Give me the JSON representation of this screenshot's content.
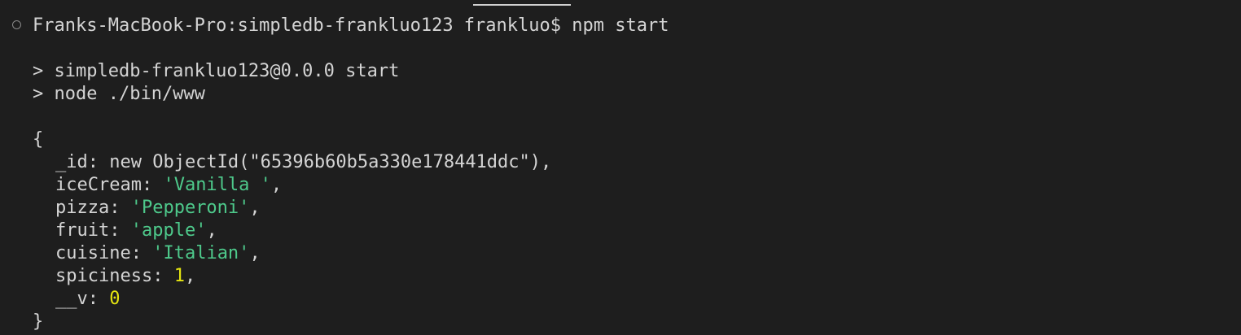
{
  "terminal": {
    "prompt": "Franks-MacBook-Pro:simpledb-frankluo123 frankluo$ npm start",
    "run_line_1": "> simpledb-frankluo123@0.0.0 start",
    "run_line_2": "> node ./bin/www",
    "open_brace": "{",
    "close_brace": "}",
    "fields": {
      "id_line": "_id: new ObjectId(\"65396b60b5a330e178441ddc\"),",
      "icecream_key": "iceCream: ",
      "icecream_val": "'Vanilla '",
      "pizza_key": "pizza: ",
      "pizza_val": "'Pepperoni'",
      "fruit_key": "fruit: ",
      "fruit_val": "'apple'",
      "cuisine_key": "cuisine: ",
      "cuisine_val": "'Italian'",
      "spiciness_key": "spiciness: ",
      "spiciness_val": "1",
      "v_key": "__v: ",
      "v_val": "0",
      "comma": ","
    },
    "colors": {
      "background": "#1e1e1e",
      "text": "#d4d4d4",
      "string": "#4ec98b",
      "number": "#e5e510"
    }
  }
}
